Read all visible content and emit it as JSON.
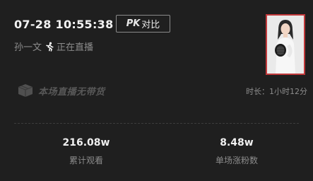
{
  "header": {
    "datetime": "07-28 10:55:38",
    "pk_button": {
      "prefix": "PK",
      "label": "对比"
    }
  },
  "streamer": {
    "name": "孙一文",
    "status": "正在直播"
  },
  "stream_info": {
    "no_goods_text": "本场直播无带货",
    "duration": "时长：1小时12分"
  },
  "stats": [
    {
      "value": "216.08w",
      "label": "累计观看"
    },
    {
      "value": "8.48w",
      "label": "单场涨粉数"
    }
  ],
  "colors": {
    "background": "#1f1f1f",
    "thumbnail_border": "#c0393b",
    "muted_text": "#8c8c8c"
  },
  "icons": {
    "live_status": "running-person-icon",
    "no_goods": "box-icon"
  }
}
